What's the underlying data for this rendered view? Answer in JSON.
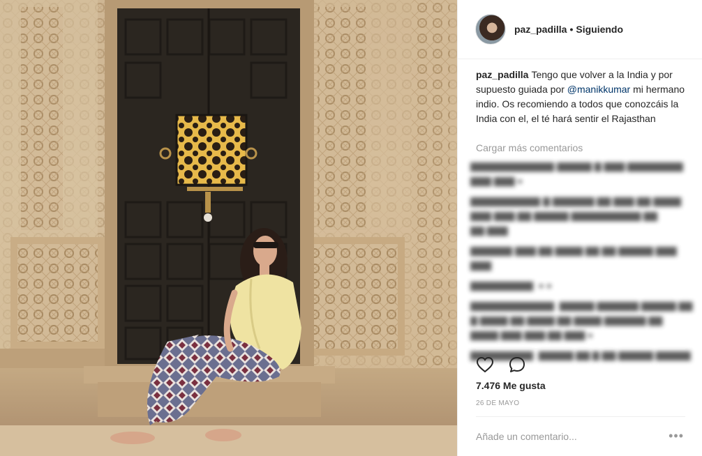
{
  "post": {
    "photo_alt": "",
    "header": {
      "username": "paz_padilla",
      "separator": "•",
      "follow_state": "Siguiendo"
    },
    "caption": {
      "username": "paz_padilla",
      "text_before": "Tengo que volver a la India y por supuesto guiada por ",
      "mention": "@manikkumar",
      "text_after": " mi hermano indio. Os recomiendo a todos que conozcáis la India con el, el té hará sentir el Rajasthan"
    },
    "load_more": "Cargar más comentarios",
    "likes": "7.476 Me gusta",
    "date": "26 DE MAYO",
    "comment_input": {
      "placeholder": "Añade un comentario..."
    },
    "more_options": "•••",
    "icons": {
      "like": "heart-icon",
      "comment": "comment-bubble-icon"
    }
  }
}
